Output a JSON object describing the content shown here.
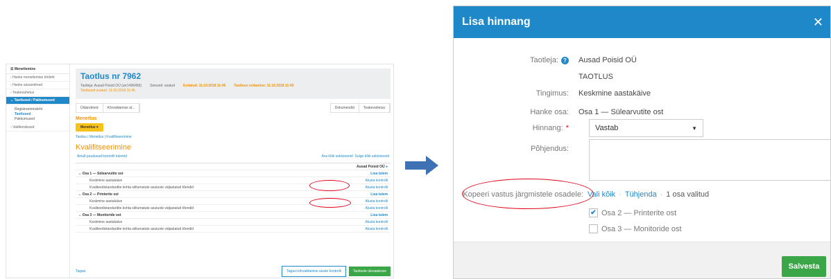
{
  "left": {
    "sidebar": {
      "header": "Menetlemine",
      "items": [
        "Hanke menetlemise tööleht",
        "Hanke alusandmed",
        "Teabevahetus",
        "Taotlused / Pakkumused",
        "Valdkondused"
      ],
      "sub_items": [
        "Registreerimisleht",
        "Taotlused",
        "Pakkumused"
      ]
    },
    "title": "Taotlus nr 7962",
    "meta_applicant": "Taotleja: Ausad Poisid OÜ (arr1496456)",
    "meta_state": "Seisund: avatud",
    "meta_submitted": "Esitatud: 11.10.2018 11:45",
    "meta_deadline": "Taotluse esitamise: 11.10.2018 11:45",
    "meta_opened": "Taotlused avatud: 11.10.2018 11:45",
    "tabs_left": [
      "Üldandmed",
      "Kõrvaldamise al..."
    ],
    "tabs_right": [
      "Dokumendid",
      "Teabevahetus"
    ],
    "section": "Menetlus",
    "section_button": "Menetlus ▾",
    "breadcrumb": "Taotlus | Menetlus | Kvalifitseerimine",
    "heading": "Kvalifitseerimine",
    "only_results": "Ainult puuduvad kontrolli tulemid",
    "expand_all": "Ava kõik sektsioonid",
    "collapse_all": "Sulge kõik sektsioonid",
    "company": "Ausad Poisid OÜ",
    "rows": [
      {
        "label": "Osa 1 — Sülearvutite ost",
        "action": "Lisa tulem",
        "bold": true
      },
      {
        "label": "Keskmine aastakäive",
        "action": "Alusta kontrolli",
        "bold": false
      },
      {
        "label": "Kvaliteedistandardite kohta siiltumatute asutuste väljastatud tõendid",
        "action": "Alusta kontrolli",
        "bold": false
      },
      {
        "label": "Osa 2 — Printerite ost",
        "action": "Lisa tulem",
        "bold": true
      },
      {
        "label": "Keskmine aastakäive",
        "action": "Alusta kontrolli",
        "bold": false
      },
      {
        "label": "Kvaliteedistandardite kohta siiltumatute asutuste väljastatud tõendid",
        "action": "Alusta kontrolli",
        "bold": false
      },
      {
        "label": "Osa 3 — Monitoride ost",
        "action": "Lisa tulem",
        "bold": true
      },
      {
        "label": "Keskmine aastakäive",
        "action": "Alusta kontrolli",
        "bold": false
      },
      {
        "label": "Kvaliteedistandardite kohta siiltumatute asutuste väljastatud tõendid",
        "action": "Alusta kontrolli",
        "bold": false
      }
    ],
    "back": "Tagasi",
    "back_check": "Tagasi kõrvaldamise aluste kontrolli",
    "next": "Taotluste ülevaatesse"
  },
  "modal": {
    "title": "Lisa hinnang",
    "close": "✕",
    "applicant_label": "Taotleja:",
    "applicant_value": "Ausad Poisid OÜ",
    "type_value": "TAOTLUS",
    "condition_label": "Tingimus:",
    "condition_value": "Keskmine aastakäive",
    "lot_label": "Hanke osa:",
    "lot_value": "Osa 1 — Sülearvutite ost",
    "rating_label": "Hinnang:",
    "rating_value": "Vastab",
    "reason_label": "Põhjendus:",
    "copy_label": "Kopeeri vastus järgmistele osadele:",
    "select_all": "Vali kõik",
    "clear": "Tühjenda",
    "selected_count": "1 osa valitud",
    "options": [
      {
        "label": "Osa 2 — Printerite ost",
        "checked": true
      },
      {
        "label": "Osa 3 — Monitoride ost",
        "checked": false
      }
    ],
    "save": "Salvesta"
  }
}
